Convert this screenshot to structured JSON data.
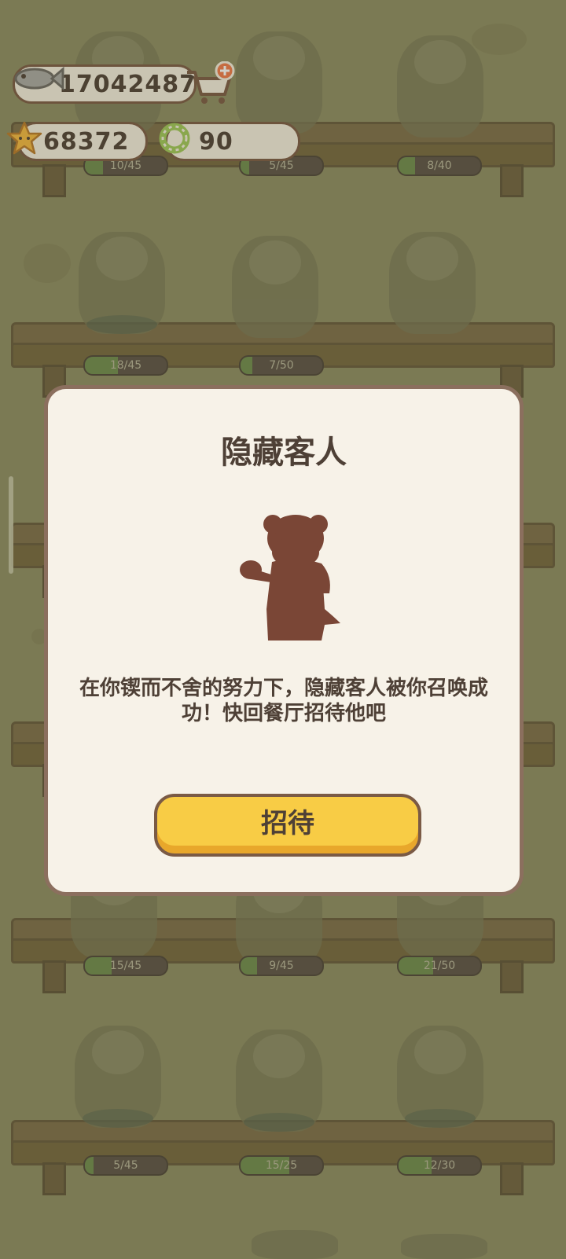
{
  "currency": {
    "fish": "17042487",
    "stars": "68372",
    "rings": "90"
  },
  "shelves": {
    "row1": [
      {
        "progress_text": "10/45",
        "fraction": 0.22
      },
      {
        "progress_text": "5/45",
        "fraction": 0.11
      },
      {
        "progress_text": "8/40",
        "fraction": 0.2
      }
    ],
    "row2": [
      {
        "progress_text": "18/45",
        "fraction": 0.4
      },
      {
        "progress_text": "7/50",
        "fraction": 0.14
      }
    ],
    "row5": [
      {
        "progress_text": "15/45",
        "fraction": 0.33
      },
      {
        "progress_text": "9/45",
        "fraction": 0.2
      },
      {
        "progress_text": "21/50",
        "fraction": 0.42
      }
    ],
    "row6": [
      {
        "progress_text": "5/45",
        "fraction": 0.11
      },
      {
        "progress_text": "15/25",
        "fraction": 0.6
      },
      {
        "progress_text": "12/30",
        "fraction": 0.4
      }
    ]
  },
  "dialog": {
    "title": "隐藏客人",
    "message": "在你锲而不舍的努力下，隐藏客人被你召唤成功！快回餐厅招待他吧",
    "button_label": "招待"
  },
  "icons": {
    "fish": "fish-icon",
    "cart": "shopping-cart-plus-icon",
    "star": "star-icon",
    "ring": "ring-icon"
  },
  "colors": {
    "accent_button": "#f8cc45",
    "dialog_bg": "#f7f2e8",
    "border": "#7a5a45",
    "text": "#4e4036"
  }
}
